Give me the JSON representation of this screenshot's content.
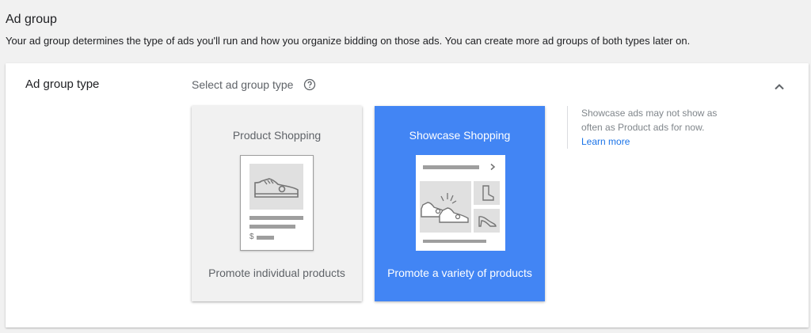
{
  "header": {
    "title": "Ad group",
    "description": "Your ad group determines the type of ads you'll run and how you organize bidding on those ads. You can create more ad groups of both types later on."
  },
  "section": {
    "label": "Ad group type",
    "select_label": "Select ad group type",
    "help_icon": "help-circle-icon",
    "collapse_icon": "chevron-up-icon"
  },
  "cards": [
    {
      "title": "Product Shopping",
      "description": "Promote individual products",
      "selected": false,
      "icon": "sneaker-icon",
      "price_symbol": "$"
    },
    {
      "title": "Showcase Shopping",
      "description": "Promote a variety of products",
      "selected": true,
      "icons": [
        "sneakers-icon",
        "boot-icon",
        "high-heel-icon",
        "chevron-right-icon"
      ]
    }
  ],
  "note": {
    "text": "Showcase ads may not show as often as Product ads for now.",
    "link": "Learn more"
  },
  "colors": {
    "accent": "#4285f4",
    "link": "#1a73e8",
    "background": "#f1f1f1"
  }
}
